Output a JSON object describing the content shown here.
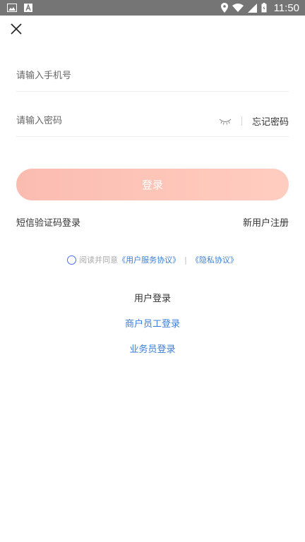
{
  "status_bar": {
    "time": "11:50",
    "left_icons": [
      "image-icon",
      "a-letter-icon"
    ],
    "right_icons": [
      "location-icon",
      "wifi-icon",
      "signal-icon",
      "battery-icon"
    ]
  },
  "form": {
    "phone_placeholder": "请输入手机号",
    "password_placeholder": "请输入密码",
    "forgot_label": "忘记密码",
    "login_label": "登录"
  },
  "links": {
    "sms_login": "短信验证码登录",
    "register": "新用户注册"
  },
  "agreement": {
    "prefix": "阅读并同意",
    "user_agreement": "《用户服务协议》",
    "separator": "|",
    "privacy": "《隐私协议》"
  },
  "roles": {
    "current": "用户登录",
    "merchant": "商户员工登录",
    "salesman": "业务员登录"
  },
  "colors": {
    "status_bar": "#757575",
    "button_start": "#fbbcb0",
    "button_end": "#ffcdc0",
    "link": "#3a7ed8",
    "radio": "#4a6cf7"
  }
}
